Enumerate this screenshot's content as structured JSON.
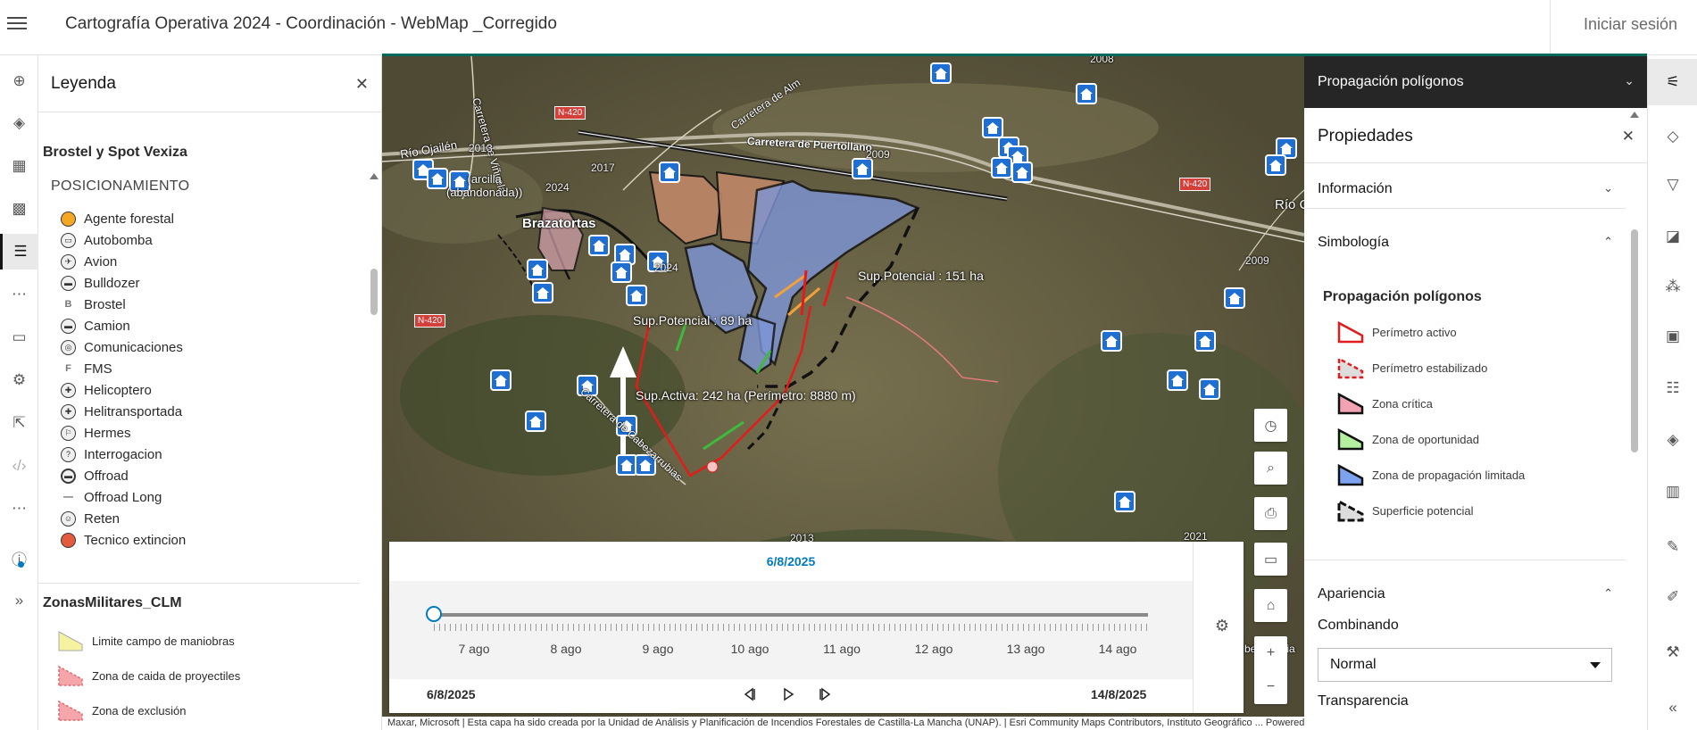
{
  "header": {
    "app_title": "Cartografía Operativa 2024 - Coordinación - WebMap _Corregido",
    "signin_label": "Iniciar sesión"
  },
  "left_toolbar": {
    "icons": [
      "add-icon",
      "layers-icon",
      "table-icon",
      "basemap-icon",
      "legend-icon",
      "more-icon",
      "folder-icon",
      "settings-icon",
      "share-icon",
      "embed-icon",
      "more-icon",
      "info-icon",
      "expand-icon"
    ]
  },
  "legend": {
    "title": "Leyenda",
    "section1": {
      "title": "Brostel y Spot Vexiza",
      "subtitle": "POSICIONAMIENTO",
      "items": [
        "Agente forestal",
        "Autobomba",
        "Avion",
        "Bulldozer",
        "Brostel",
        "Camion",
        "Comunicaciones",
        "FMS",
        "Helicoptero",
        "Helitransportada",
        "Hermes",
        "Interrogacion",
        "Offroad",
        "Offroad Long",
        "Reten",
        "Tecnico extincion"
      ]
    },
    "section2": {
      "title": "ZonasMilitares_CLM",
      "items": [
        "Limite campo de maniobras",
        "Zona de caida de proyectiles",
        "Zona de exclusión"
      ]
    }
  },
  "map": {
    "place_labels": {
      "brazatortas": "Brazatortas",
      "arcilla": "(arcilla\n(abandonada))",
      "rio_ojailen": "Río Ojailén",
      "rio_c": "Río C"
    },
    "roads": {
      "n420_a": "N-420",
      "n420_b": "N-420",
      "n420_c": "N-420",
      "puertollano": "Carretera de Puertollano",
      "almodovar": "Carretera de Alm",
      "viso": "Carretera de Viñuela",
      "cabezarrubias": "Carretera de Cabezarrubias",
      "cabezarrubias_short": "bezarrubia"
    },
    "years": [
      "2013",
      "2017",
      "2024",
      "2024",
      "2009",
      "2009",
      "2013",
      "2021",
      "2008"
    ],
    "sup_labels": {
      "potencial_89": "Sup.Potencial : 89 ha",
      "potencial_151": "Sup.Potencial : 151 ha",
      "activa": "Sup.Activa: 242 ha  (Perímetro: 8880 m)"
    },
    "attribution": "Maxar, Microsoft | Esta capa ha sido creada por la Unidad de Análisis y Planificación de Incendios Forestales de Castilla-La Mancha (UNAP). | Esri Community Maps Contributors, Instituto Geográfico ...   Powered by Esri"
  },
  "map_controls": {
    "icons": [
      "clock-icon",
      "search-icon",
      "print-icon",
      "monitor-icon",
      "home-icon",
      "zoom-in-icon",
      "zoom-out-icon"
    ],
    "zoom_in": "+",
    "zoom_out": "−"
  },
  "time_slider": {
    "current_date": "6/8/2025",
    "start_date": "6/8/2025",
    "end_date": "14/8/2025",
    "labels": [
      "7 ago",
      "8 ago",
      "9 ago",
      "10 ago",
      "11 ago",
      "12 ago",
      "13 ago",
      "14 ago"
    ],
    "position_fraction": 0
  },
  "right_panel": {
    "layer_title": "Propagación polígonos",
    "properties_title": "Propiedades",
    "sections": {
      "informacion": "Información",
      "simbologia": "Simbología",
      "apariencia": "Apariencia"
    },
    "symbology": {
      "title": "Propagación polígonos",
      "items": [
        "Perímetro activo",
        "Perímetro estabilizado",
        "Zona crítica",
        "Zona de oportunidad",
        "Zona de propagación limitada",
        "Superficie potencial"
      ]
    },
    "blend": {
      "label": "Combinando",
      "value": "Normal"
    },
    "transparency_label": "Transparencia"
  },
  "right_toolbar": {
    "icons": [
      "properties-icon",
      "styles-icon",
      "filter-icon",
      "effects-icon",
      "clustering-icon",
      "popups-icon",
      "fields-icon",
      "labels-icon",
      "charts-icon",
      "sketch-icon",
      "measure-icon",
      "tools-icon",
      "collapse-icon"
    ]
  },
  "colors": {
    "accent_blue": "#007ac2",
    "header_teal": "#00695c",
    "dark_panel": "#262626",
    "house_blue": "#1e6fd1",
    "perimeter_red": "#e21b1b",
    "critical_pink": "#f2a3b3",
    "opportunity_green": "#b5f0a0",
    "limited_blue": "#7da2f0"
  }
}
